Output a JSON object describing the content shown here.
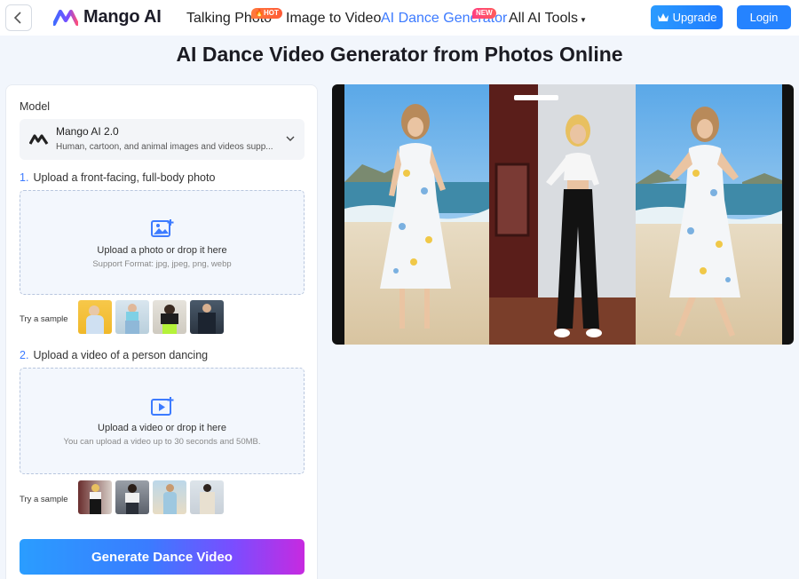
{
  "header": {
    "logo_text": "Mango AI",
    "nav": [
      {
        "label": "Talking Photo",
        "badge": "HOT"
      },
      {
        "label": "Image to Video"
      },
      {
        "label": "AI Dance Generator",
        "badge": "NEW",
        "active": true
      },
      {
        "label": "All AI Tools"
      }
    ],
    "upgrade_label": "Upgrade",
    "login_label": "Login"
  },
  "page_title": "AI Dance Video Generator from Photos Online",
  "panel": {
    "model_label": "Model",
    "model_name": "Mango AI 2.0",
    "model_desc": "Human, cartoon, and animal images and videos supp...",
    "step1_num": "1.",
    "step1_label": "Upload a front-facing, full-body photo",
    "photo_upload_title": "Upload a photo or drop it here",
    "photo_upload_sub": "Support Format: jpg, jpeg, png, webp",
    "try_sample_1": "Try a sample",
    "step2_num": "2.",
    "step2_label": "Upload a video of a person dancing",
    "video_upload_title": "Upload a video or drop it here",
    "video_upload_sub": "You can upload a video up to 30 seconds and 50MB.",
    "try_sample_2": "Try a sample",
    "generate_label": "Generate Dance Video"
  },
  "colors": {
    "accent": "#3d7bff",
    "upgrade": "#1f7bff",
    "login": "#2583ff"
  }
}
